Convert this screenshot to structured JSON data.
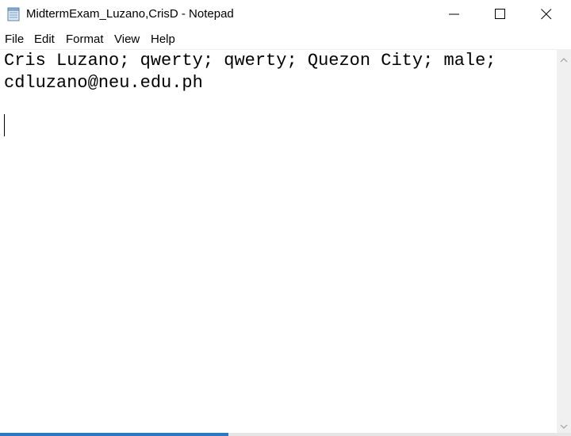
{
  "window": {
    "title": "MidtermExam_Luzano,CrisD - Notepad",
    "app_icon": "notepad-icon",
    "controls": {
      "minimize_icon": "minimize-icon",
      "maximize_icon": "maximize-icon",
      "close_icon": "close-icon"
    }
  },
  "menu": {
    "items": [
      "File",
      "Edit",
      "Format",
      "View",
      "Help"
    ]
  },
  "editor": {
    "lines": [
      "Cris Luzano; qwerty; qwerty; Quezon City; male;",
      "cdluzano@neu.edu.ph"
    ]
  },
  "colors": {
    "accent": "#2b78c4",
    "scrollbar": "#f0f0f0"
  }
}
